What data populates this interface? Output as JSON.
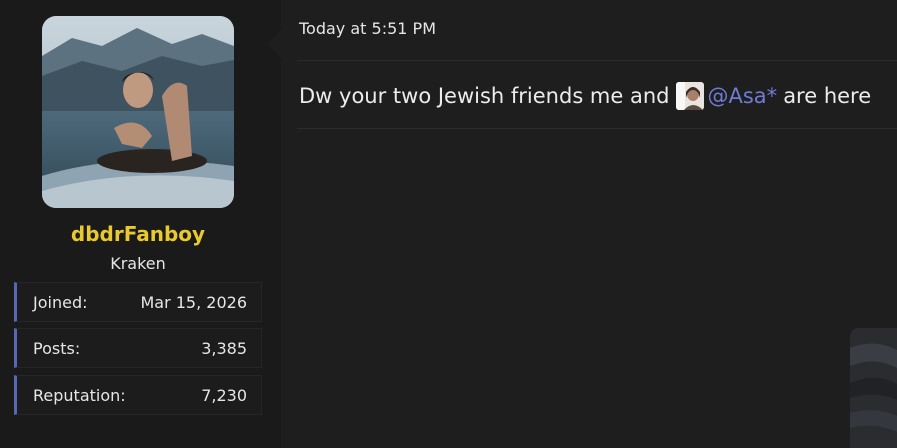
{
  "user": {
    "name": "dbdrFanboy",
    "title": "Kraken",
    "name_color": "#e8c92e",
    "stats": [
      {
        "label": "Joined:",
        "value": "Mar 15, 2026"
      },
      {
        "label": "Posts:",
        "value": "3,385"
      },
      {
        "label": "Reputation:",
        "value": "7,230"
      }
    ]
  },
  "post": {
    "timestamp": "Today at 5:51 PM",
    "message_before": "Dw your two Jewish friends me and",
    "mention": "@Asa*",
    "message_after": "are here",
    "mention_color": "#6f7cd6"
  },
  "colors": {
    "accent": "#5866b8",
    "background": "#1e1e1e",
    "sidebar": "#1a1a1a"
  }
}
